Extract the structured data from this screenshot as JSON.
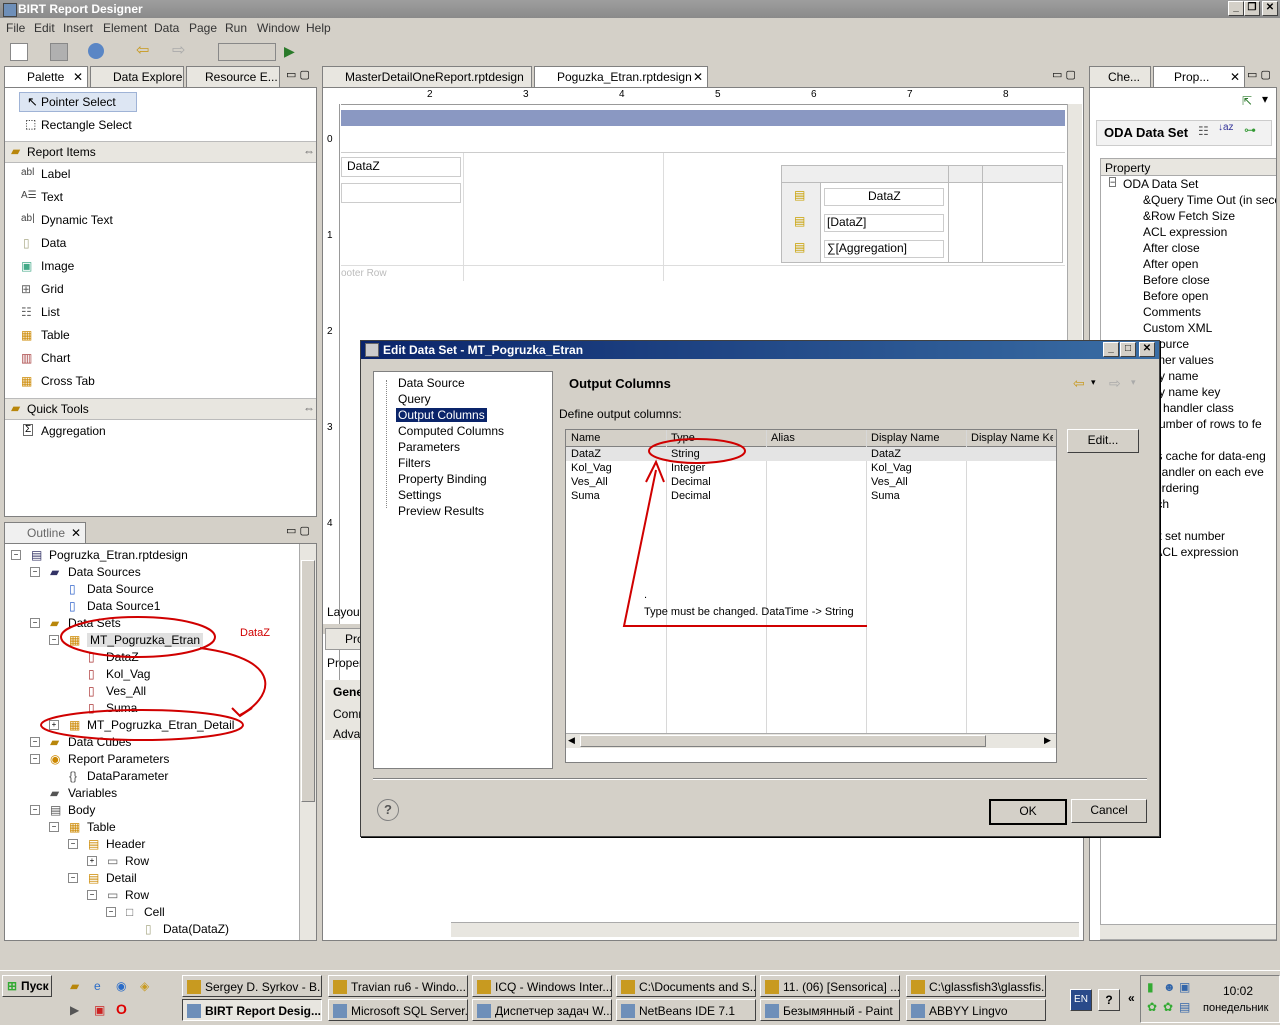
{
  "window": {
    "title": "BIRT Report Designer"
  },
  "menu": [
    "File",
    "Edit",
    "Insert",
    "Element",
    "Data",
    "Page",
    "Run",
    "Window",
    "Help"
  ],
  "palette_tabs": [
    "Palette",
    "Data Explorer",
    "Resource E..."
  ],
  "palette": {
    "pointer": "Pointer Select",
    "rectangle": "Rectangle Select",
    "report_items_header": "Report Items",
    "items": [
      "Label",
      "Text",
      "Dynamic Text",
      "Data",
      "Image",
      "Grid",
      "List",
      "Table",
      "Chart",
      "Cross Tab"
    ],
    "quick_tools_header": "Quick Tools",
    "quick_items": [
      "Aggregation"
    ]
  },
  "editor_tabs": [
    "MasterDetailOneReport.rptdesign",
    "Poguzka_Etran.rptdesign"
  ],
  "ruler_numbers": [
    "2",
    "3",
    "4",
    "5",
    "6",
    "7",
    "8"
  ],
  "ruler_v_numbers": [
    "0",
    "1",
    "2",
    "3",
    "4"
  ],
  "canvas": {
    "cell_dataz": "DataZ",
    "footer_row": "ooter Row",
    "inner_header": "DataZ",
    "inner_detail": "[DataZ]",
    "inner_agg": "[Aggregation]",
    "layout_tab": "Layout"
  },
  "prop_panel_partial": {
    "tab": "Pro",
    "sub": "Proper",
    "items": [
      "Gene",
      "Comm",
      "Adva"
    ]
  },
  "outline": {
    "tab": "Outline",
    "nodes": [
      {
        "label": "Pogruzka_Etran.rptdesign",
        "depth": 0
      },
      {
        "label": "Data Sources",
        "depth": 1
      },
      {
        "label": "Data Source",
        "depth": 2
      },
      {
        "label": "Data Source1",
        "depth": 2
      },
      {
        "label": "Data Sets",
        "depth": 1
      },
      {
        "label": "MT_Pogruzka_Etran",
        "depth": 2
      },
      {
        "label": "DataZ",
        "depth": 3
      },
      {
        "label": "Kol_Vag",
        "depth": 3
      },
      {
        "label": "Ves_All",
        "depth": 3
      },
      {
        "label": "Suma",
        "depth": 3
      },
      {
        "label": "MT_Pogruzka_Etran_Detail",
        "depth": 2
      },
      {
        "label": "Data Cubes",
        "depth": 1
      },
      {
        "label": "Report Parameters",
        "depth": 1
      },
      {
        "label": "DataParameter",
        "depth": 2
      },
      {
        "label": "Variables",
        "depth": 1
      },
      {
        "label": "Body",
        "depth": 1
      },
      {
        "label": "Table",
        "depth": 2
      },
      {
        "label": "Header",
        "depth": 3
      },
      {
        "label": "Row",
        "depth": 4
      },
      {
        "label": "Detail",
        "depth": 3
      },
      {
        "label": "Row",
        "depth": 4
      },
      {
        "label": "Cell",
        "depth": 5
      },
      {
        "label": "Data(DataZ)",
        "depth": 6
      }
    ],
    "annotation": "DataZ"
  },
  "right_tabs": [
    "Che...",
    "Prop..."
  ],
  "right_panel": {
    "title": "ODA Data Set",
    "column_header": "Property",
    "group": "ODA Data Set",
    "props": [
      "&Query Time Out (in seco",
      "&Row Fetch Size",
      "ACL expression",
      "After close",
      "After open",
      "Before close",
      "Before open",
      "Comments",
      "Custom XML",
      "a source",
      "signer values",
      "play name",
      "play name key",
      "ent handler class",
      "x number of rows to fe",
      "ne",
      "eds cache for data-eng",
      "w handler on each eve",
      "s Ordering",
      "fetch",
      "ery",
      "sult set number",
      "w ACL expression",
      "ale"
    ]
  },
  "dialog": {
    "title": "Edit Data Set - MT_Pogruzka_Etran",
    "nav": [
      "Data Source",
      "Query",
      "Output Columns",
      "Computed Columns",
      "Parameters",
      "Filters",
      "Property Binding",
      "Settings",
      "Preview Results"
    ],
    "selected_nav": "Output Columns",
    "heading": "Output Columns",
    "subheading": "Define output columns:",
    "columns": [
      "Name",
      "Type",
      "Alias",
      "Display Name",
      "Display Name Key"
    ],
    "rows": [
      [
        "DataZ",
        "String",
        "",
        "DataZ",
        ""
      ],
      [
        "Kol_Vag",
        "Integer",
        "",
        "Kol_Vag",
        ""
      ],
      [
        "Ves_All",
        "Decimal",
        "",
        "Ves_All",
        ""
      ],
      [
        "Suma",
        "Decimal",
        "",
        "Suma",
        ""
      ]
    ],
    "edit_button": "Edit...",
    "annotation_dot": ".",
    "annotation": "Type must be changed. DataTime -> String",
    "ok": "OK",
    "cancel": "Cancel"
  },
  "taskbar": {
    "start": "Пуск",
    "row1": [
      "Sergey D. Syrkov - B...",
      "Travian ru6 - Windo...",
      "ICQ - Windows Inter...",
      "C:\\Documents and S...",
      "11. (06) [Sensorica] ...",
      "C:\\glassfish3\\glassfis..."
    ],
    "row2": [
      "BIRT Report Desig...",
      "Microsoft SQL Server...",
      "Диспетчер задач W...",
      "NetBeans IDE 7.1",
      "Безымянный - Paint",
      "ABBYY Lingvo"
    ],
    "lang": "EN",
    "clock": "10:02",
    "day": "понедельник"
  }
}
